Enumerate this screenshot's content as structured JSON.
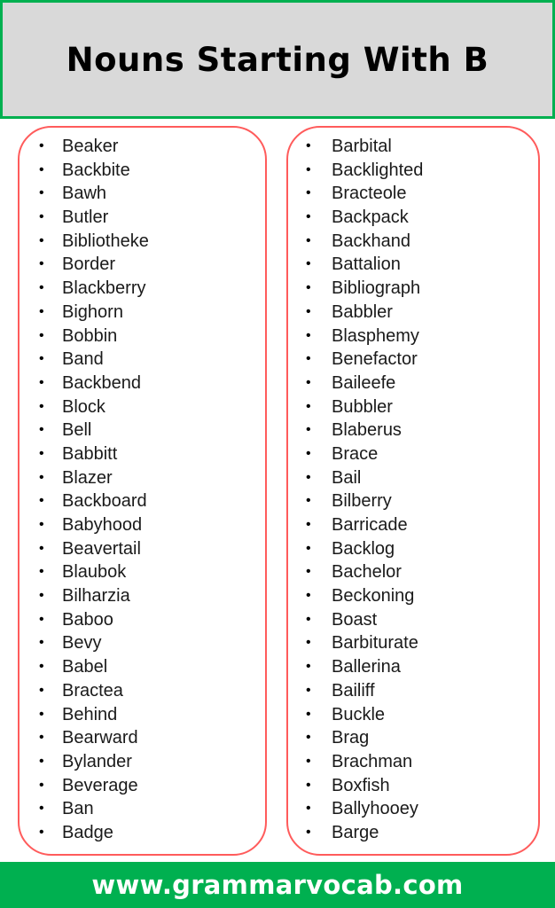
{
  "header": {
    "title": "Nouns Starting With B"
  },
  "colors": {
    "header_border": "#00b050",
    "header_bg": "#d9d9d9",
    "box_border": "#ff5b5b",
    "footer_bg": "#00b050"
  },
  "left_column": {
    "bullet_icon": "bullet-dot",
    "items": [
      "Beaker",
      "Backbite",
      "Bawh",
      "Butler",
      "Bibliotheke",
      "Border",
      "Blackberry",
      "Bighorn",
      "Bobbin",
      "Band",
      "Backbend",
      "Block",
      "Bell",
      "Babbitt",
      "Blazer",
      "Backboard",
      "Babyhood",
      "Beavertail",
      "Blaubok",
      "Bilharzia",
      "Baboo",
      "Bevy",
      "Babel",
      "Bractea",
      "Behind",
      "Bearward",
      "Bylander",
      "Beverage",
      "Ban",
      "Badge"
    ]
  },
  "right_column": {
    "bullet_icon": "bullet-dot",
    "items": [
      "Barbital",
      "Backlighted",
      "Bracteole",
      "Backpack",
      "Backhand",
      "Battalion",
      "Bibliograph",
      "Babbler",
      "Blasphemy",
      "Benefactor",
      "Baileefe",
      "Bubbler",
      "Blaberus",
      "Brace",
      "Bail",
      "Bilberry",
      "Barricade",
      "Backlog",
      "Bachelor",
      "Beckoning",
      "Boast",
      "Barbiturate",
      "Ballerina",
      "Bailiff",
      "Buckle",
      "Brag",
      "Brachman",
      "Boxfish",
      "Ballyhooey",
      "Barge"
    ]
  },
  "footer": {
    "website": "www.grammarvocab.com"
  }
}
